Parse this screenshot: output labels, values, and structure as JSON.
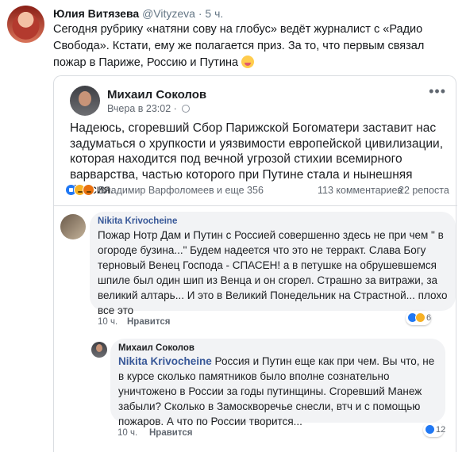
{
  "tweet": {
    "author_name": "Юлия Витязева",
    "handle": "@Vityzeva",
    "separator": "·",
    "time": "5 ч.",
    "text": "Сегодня рубрику «натяни сову на глобус» ведёт журналист с «Радио Свобода». Кстати, ему же полагается приз. За то, что первым связал пожар в Париже, Россию и Путина",
    "emoji_icon": "squinting-tongue-face-icon"
  },
  "post": {
    "author": "Михаил Соколов",
    "time": "Вчера в 23:02",
    "separator": "·",
    "privacy_icon": "globe-icon",
    "more_label": "•••",
    "text": "Надеюсь, сгоревший Сбор Парижской Богоматери заставит нас задуматься о хрупкости и уязвимости европейской цивилизации, которая находится под вечной угрозой стихии всемирного варварства, частью которого при Путине стала и нынешняя Россия.",
    "reactions": [
      "like",
      "sad",
      "angry"
    ],
    "reactors": "Владимир Варфоломеев и еще 356",
    "comments_count": "113 комментариев",
    "shares_count": "22 репоста"
  },
  "comments": [
    {
      "author": "Nikita Krivocheine",
      "text": "Пожар Нотр Дам и Путин с Россией совершенно   здесь не при чем \" в огороде бузина...\" Будем надеется что это не терракт. Слава Богу терновый Венец Господа - СПАСЕН! а в петушке на обрушевшемся шпиле был один шип из Венца и он сгорел. Страшно за витражи, за великий алтарь... И это в Великий Понедельник на Страстной... плохо все это",
      "time": "10 ч.",
      "like_label": "Нравится",
      "reaction_count": "6"
    },
    {
      "author": "Михаил Соколов",
      "mention": "Nikita Krivocheine",
      "text": " Россия и Путин еще как при чем. Вы что, не в курсе сколько памятников было вполне сознательно уничтожено в России за годы путинщины. Сгоревший Манеж забыли? Сколько в Замоскворечье снесли, втч и с помощью пожаров. А что по России творится...",
      "time": "10 ч.",
      "like_label": "Нравится",
      "reaction_count": "12"
    }
  ],
  "colors": {
    "link_blue": "#385898",
    "like_blue": "#2078f4",
    "bubble_gray": "#f2f3f5",
    "meta_gray": "#606770",
    "twitter_gray": "#657786"
  }
}
